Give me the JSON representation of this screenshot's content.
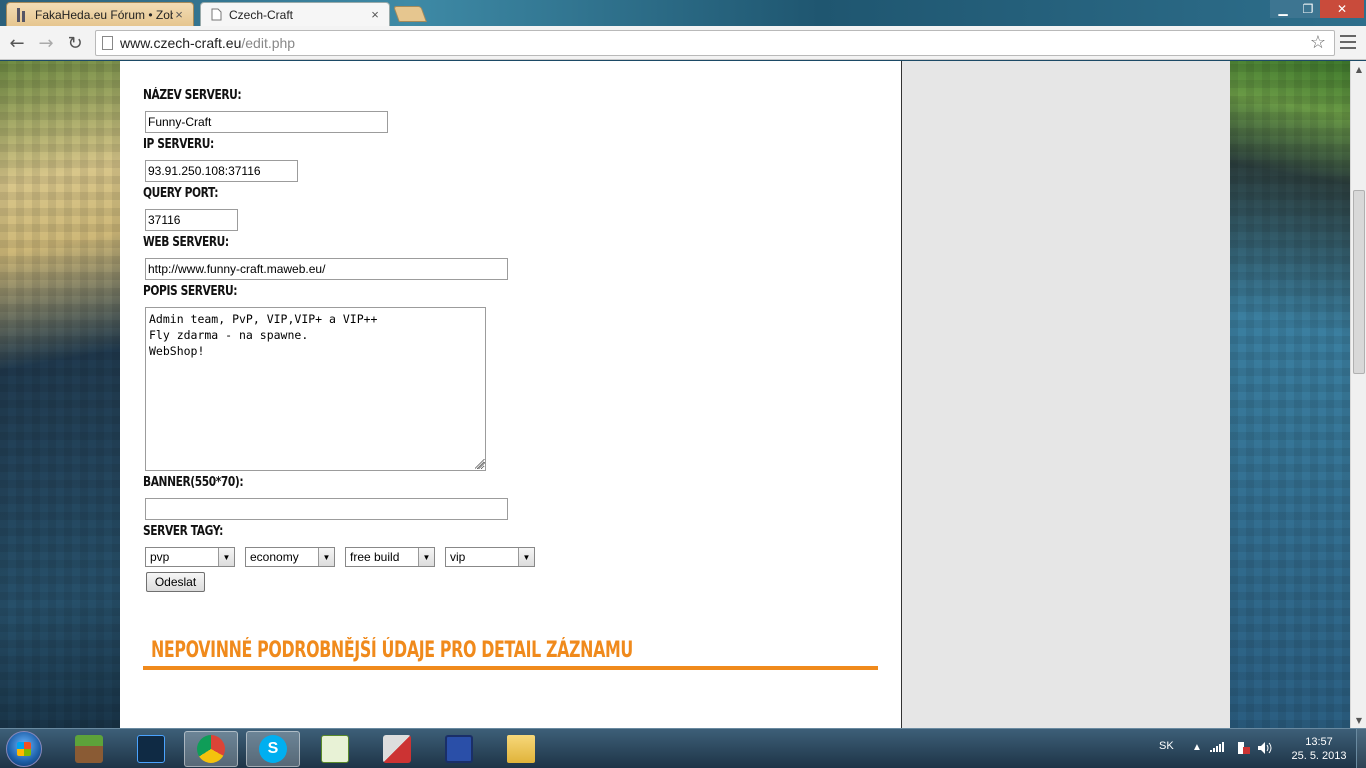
{
  "browser": {
    "tabs": [
      {
        "title": "FakaHeda.eu Fórum • Zob",
        "close": "×"
      },
      {
        "title": "Czech-Craft",
        "close": "×"
      }
    ],
    "url_host": "www.czech-craft.eu",
    "url_path": "/edit.php",
    "window_controls": {
      "minimize": "▁",
      "maximize": "❐",
      "close": "✕"
    },
    "nav": {
      "back": "←",
      "forward": "→",
      "reload": "↻",
      "star": "☆"
    }
  },
  "form": {
    "name_label": "Název serveru:",
    "name_value": "Funny-Craft",
    "ip_label": "IP serveru:",
    "ip_value": "93.91.250.108:37116",
    "query_label": "Query port:",
    "query_value": "37116",
    "web_label": "Web serveru:",
    "web_value": "http://www.funny-craft.maweb.eu/",
    "desc_label": "Popis serveru:",
    "desc_value": "Admin team, PvP, VIP,VIP+ a VIP++\nFly zdarma - na spawne.\nWebShop!",
    "banner_label": "Banner(550*70):",
    "banner_value": "",
    "tags_label": "Server tagy:",
    "tags": [
      "pvp",
      "economy",
      "free build",
      "vip"
    ],
    "submit_label": "Odeslat"
  },
  "section": {
    "title": "Nepovinné podrobnější údaje pro detail záznamu"
  },
  "taskbar": {
    "language": "SK",
    "time": "13:57",
    "date": "25. 5. 2013",
    "apps": [
      "minecraft-icon",
      "app-icon",
      "chrome-icon",
      "skype-icon",
      "notepad-plus-icon",
      "paint-icon",
      "save-icon",
      "explorer-icon"
    ]
  },
  "colors": {
    "accent": "#f08a1c",
    "sidebar_bg": "#e6e6e6"
  }
}
